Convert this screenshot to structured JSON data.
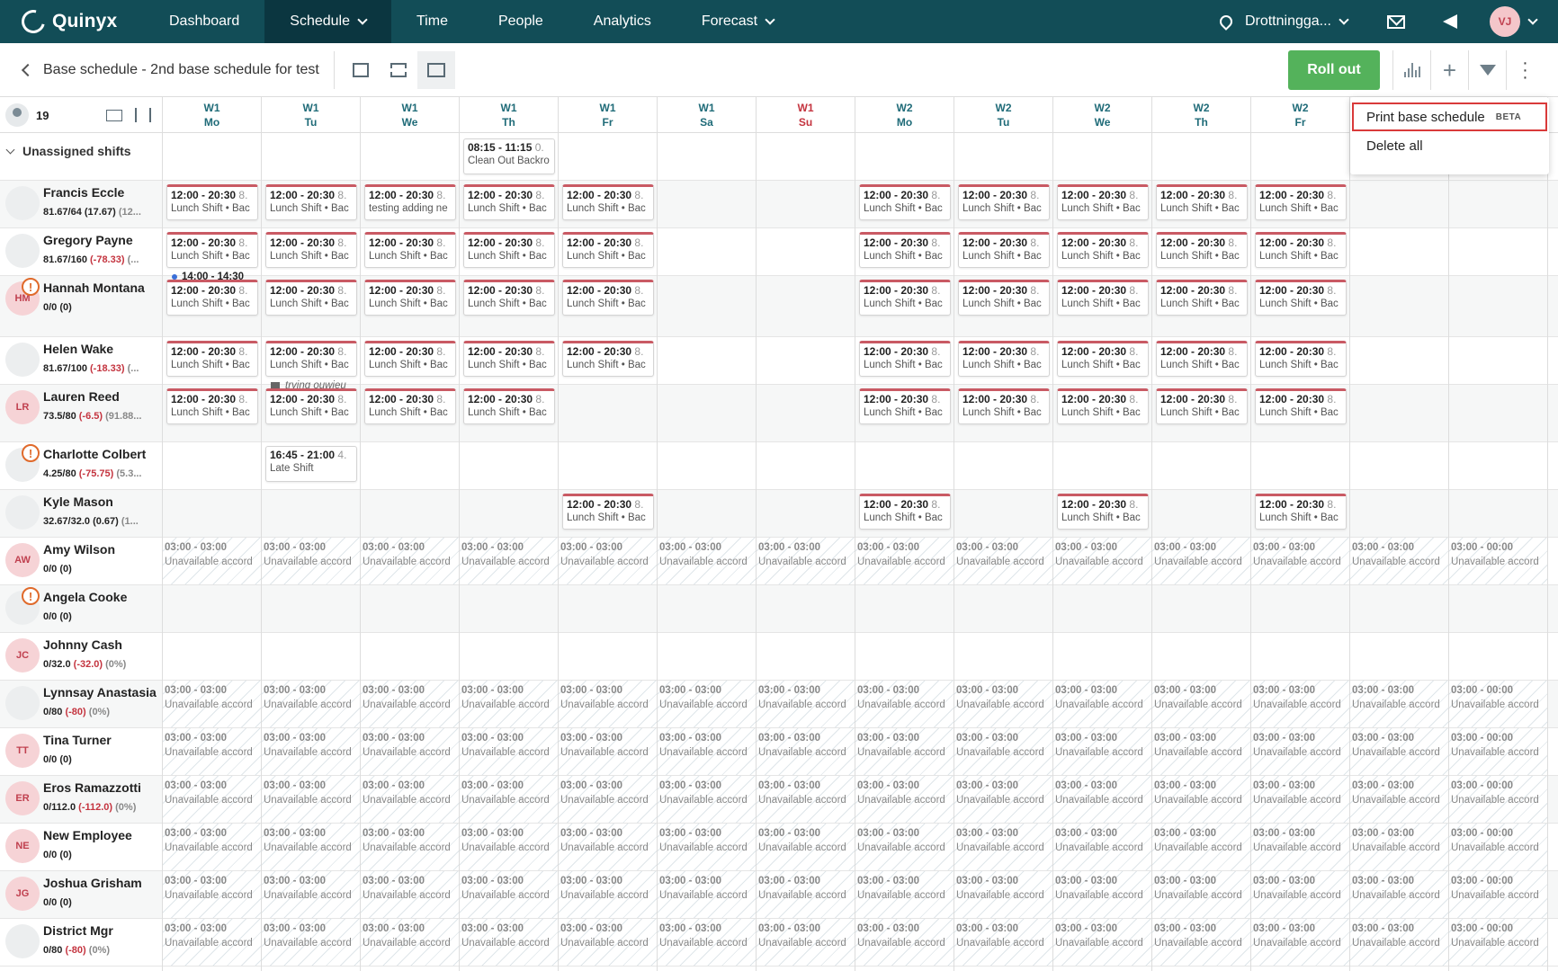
{
  "nav": {
    "logo": "Quinyx",
    "items": [
      {
        "label": "Dashboard",
        "active": false,
        "dropdown": false
      },
      {
        "label": "Schedule",
        "active": true,
        "dropdown": true
      },
      {
        "label": "Time",
        "active": false,
        "dropdown": false
      },
      {
        "label": "People",
        "active": false,
        "dropdown": false
      },
      {
        "label": "Analytics",
        "active": false,
        "dropdown": false
      },
      {
        "label": "Forecast",
        "active": false,
        "dropdown": true
      }
    ],
    "location": "Drottningga...",
    "avatar_initials": "VJ"
  },
  "toolbar": {
    "title": "Base schedule - 2nd base schedule for test",
    "rollout_label": "Roll out"
  },
  "grid": {
    "count": "19",
    "unassigned_label": "Unassigned shifts",
    "days": [
      {
        "w": "W1",
        "d": "Mo",
        "sun": false
      },
      {
        "w": "W1",
        "d": "Tu",
        "sun": false
      },
      {
        "w": "W1",
        "d": "We",
        "sun": false
      },
      {
        "w": "W1",
        "d": "Th",
        "sun": false
      },
      {
        "w": "W1",
        "d": "Fr",
        "sun": false
      },
      {
        "w": "W1",
        "d": "Sa",
        "sun": false
      },
      {
        "w": "W1",
        "d": "Su",
        "sun": true
      },
      {
        "w": "W2",
        "d": "Mo",
        "sun": false
      },
      {
        "w": "W2",
        "d": "Tu",
        "sun": false
      },
      {
        "w": "W2",
        "d": "We",
        "sun": false
      },
      {
        "w": "W2",
        "d": "Th",
        "sun": false
      },
      {
        "w": "W2",
        "d": "Fr",
        "sun": false
      },
      {
        "w": "",
        "d": "",
        "sun": false
      },
      {
        "w": "",
        "d": "",
        "sun": false
      }
    ],
    "unassigned_shifts": [
      {
        "day": 3,
        "time": "08:15 - 11:15",
        "dur": "0.",
        "desc": "Clean Out Backro"
      }
    ],
    "employees": [
      {
        "name": "Francis Eccle",
        "hours": "81.67/64",
        "diff": "(17.67)",
        "diff_neg": false,
        "extra": "(12...",
        "initials": "",
        "pink": false,
        "warn": false,
        "shifts": [
          0,
          1,
          2,
          3,
          4,
          7,
          8,
          9,
          10,
          11
        ],
        "unav": [],
        "shift_desc": {
          "2": "testing adding ne"
        },
        "note": null
      },
      {
        "name": "Gregory Payne",
        "hours": "81.67/160",
        "diff": "(-78.33)",
        "diff_neg": true,
        "extra": "(...",
        "initials": "",
        "pink": false,
        "warn": false,
        "shifts": [
          0,
          1,
          2,
          3,
          4,
          7,
          8,
          9,
          10,
          11
        ],
        "unav": [],
        "shift_desc": {},
        "note": {
          "day": 0,
          "kind": "dot",
          "text": "14:00 - 14:30"
        }
      },
      {
        "name": "Hannah Montana",
        "hours": "0/0",
        "diff": "(0)",
        "diff_neg": false,
        "extra": "",
        "initials": "HM",
        "pink": true,
        "warn": true,
        "shifts": [
          0,
          1,
          2,
          3,
          4,
          7,
          8,
          9,
          10,
          11
        ],
        "unav": [],
        "shift_desc": {},
        "note": null
      },
      {
        "name": "Helen Wake",
        "hours": "81.67/100",
        "diff": "(-18.33)",
        "diff_neg": true,
        "extra": "(...",
        "initials": "",
        "pink": false,
        "warn": false,
        "shifts": [
          0,
          1,
          2,
          3,
          4,
          7,
          8,
          9,
          10,
          11
        ],
        "unav": [],
        "shift_desc": {},
        "note": {
          "day": 1,
          "kind": "comment",
          "text": "trying ouwieu"
        }
      },
      {
        "name": "Lauren Reed",
        "hours": "73.5/80",
        "diff": "(-6.5)",
        "diff_neg": true,
        "extra": "(91.88...",
        "initials": "LR",
        "pink": true,
        "warn": false,
        "shifts": [
          0,
          1,
          2,
          3,
          7,
          8,
          9,
          10,
          11
        ],
        "unav": [],
        "shift_desc": {},
        "note": null
      },
      {
        "name": "Charlotte Colbert",
        "hours": "4.25/80",
        "diff": "(-75.75)",
        "diff_neg": true,
        "extra": "(5.3...",
        "initials": "",
        "pink": false,
        "warn": true,
        "shifts": [],
        "unav": [],
        "shift_desc": {},
        "note": null,
        "late": {
          "day": 1,
          "time": "16:45 - 21:00",
          "dur": "4.",
          "desc": "Late Shift"
        }
      },
      {
        "name": "Kyle Mason",
        "hours": "32.67/32.0",
        "diff": "(0.67)",
        "diff_neg": false,
        "extra": "(1...",
        "initials": "",
        "pink": false,
        "warn": false,
        "shifts": [
          4,
          7,
          9,
          11
        ],
        "unav": [],
        "shift_desc": {},
        "note": null
      },
      {
        "name": "Amy Wilson",
        "hours": "0/0",
        "diff": "(0)",
        "diff_neg": false,
        "extra": "",
        "initials": "AW",
        "pink": true,
        "warn": false,
        "shifts": [],
        "unav": [
          0,
          1,
          2,
          3,
          4,
          5,
          6,
          7,
          8,
          9,
          10,
          11,
          12,
          13
        ],
        "shift_desc": {},
        "note": null
      },
      {
        "name": "Angela Cooke",
        "hours": "0/0",
        "diff": "(0)",
        "diff_neg": false,
        "extra": "",
        "initials": "",
        "pink": false,
        "warn": true,
        "shifts": [],
        "unav": [],
        "shift_desc": {},
        "note": null
      },
      {
        "name": "Johnny Cash",
        "hours": "0/32.0",
        "diff": "(-32.0)",
        "diff_neg": true,
        "extra": "(0%)",
        "initials": "JC",
        "pink": true,
        "warn": false,
        "shifts": [],
        "unav": [],
        "shift_desc": {},
        "note": null
      },
      {
        "name": "Lynnsay Anastasia",
        "hours": "0/80",
        "diff": "(-80)",
        "diff_neg": true,
        "extra": "(0%)",
        "initials": "",
        "pink": false,
        "warn": false,
        "shifts": [],
        "unav": [
          0,
          1,
          2,
          3,
          4,
          5,
          6,
          7,
          8,
          9,
          10,
          11,
          12,
          13
        ],
        "shift_desc": {},
        "note": null
      },
      {
        "name": "Tina Turner",
        "hours": "0/0",
        "diff": "(0)",
        "diff_neg": false,
        "extra": "",
        "initials": "TT",
        "pink": true,
        "warn": false,
        "shifts": [],
        "unav": [
          0,
          1,
          2,
          3,
          4,
          5,
          6,
          7,
          8,
          9,
          10,
          11,
          12,
          13
        ],
        "shift_desc": {},
        "note": null
      },
      {
        "name": "Eros Ramazzotti",
        "hours": "0/112.0",
        "diff": "(-112.0)",
        "diff_neg": true,
        "extra": "(0%)",
        "initials": "ER",
        "pink": true,
        "warn": false,
        "shifts": [],
        "unav": [
          0,
          1,
          2,
          3,
          4,
          5,
          6,
          7,
          8,
          9,
          10,
          11,
          12,
          13
        ],
        "shift_desc": {},
        "note": null
      },
      {
        "name": "New Employee",
        "hours": "0/0",
        "diff": "(0)",
        "diff_neg": false,
        "extra": "",
        "initials": "NE",
        "pink": true,
        "warn": false,
        "shifts": [],
        "unav": [
          0,
          1,
          2,
          3,
          4,
          5,
          6,
          7,
          8,
          9,
          10,
          11,
          12,
          13
        ],
        "shift_desc": {},
        "note": null
      },
      {
        "name": "Joshua Grisham",
        "hours": "0/0",
        "diff": "(0)",
        "diff_neg": false,
        "extra": "",
        "initials": "JG",
        "pink": true,
        "warn": false,
        "shifts": [],
        "unav": [
          0,
          1,
          2,
          3,
          4,
          5,
          6,
          7,
          8,
          9,
          10,
          11,
          12,
          13
        ],
        "shift_desc": {},
        "note": null
      },
      {
        "name": "District Mgr",
        "hours": "0/80",
        "diff": "(-80)",
        "diff_neg": true,
        "extra": "(0%)",
        "initials": "",
        "pink": false,
        "warn": false,
        "shifts": [],
        "unav": [
          0,
          1,
          2,
          3,
          4,
          5,
          6,
          7,
          8,
          9,
          10,
          11,
          12,
          13
        ],
        "shift_desc": {},
        "note": null
      }
    ],
    "shift_time": "12:00 - 20:30",
    "shift_dur": "8.",
    "shift_desc_default": "Lunch Shift • Bac",
    "unav_time": "03:00 - 03:00",
    "unav_time_last": "03:00 - 00:00",
    "unav_desc": "Unavailable accord"
  },
  "menu": {
    "items": [
      {
        "label": "Print base schedule",
        "badge": "BETA"
      },
      {
        "label": "Delete all",
        "badge": ""
      }
    ]
  },
  "colors": {
    "nav_bg": "#124d57",
    "rollout": "#54b25b",
    "shift_accent": "#c95a64",
    "highlight": "#d93a3a"
  }
}
